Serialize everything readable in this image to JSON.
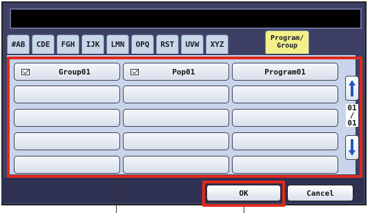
{
  "display": {
    "text": ""
  },
  "tabs": [
    "#AB",
    "CDE",
    "FGH",
    "IJK",
    "LMN",
    "OPQ",
    "RST",
    "UVW",
    "XYZ"
  ],
  "active_tab": {
    "line1": "Program/",
    "line2": "Group"
  },
  "grid": {
    "row1": [
      {
        "label": "Group01",
        "icon": "envelope-icon"
      },
      {
        "label": "Pop01",
        "icon": "envelope-icon"
      },
      {
        "label": "Program01"
      }
    ]
  },
  "page_indicator": {
    "current": "01",
    "sep": "/",
    "total": "01"
  },
  "actions": {
    "ok": "OK",
    "cancel": "Cancel"
  },
  "colors": {
    "highlight": "#e02a1a",
    "active_tab": "#f3f089",
    "panel": "#c9d5ea",
    "screen": "#3d4064"
  }
}
